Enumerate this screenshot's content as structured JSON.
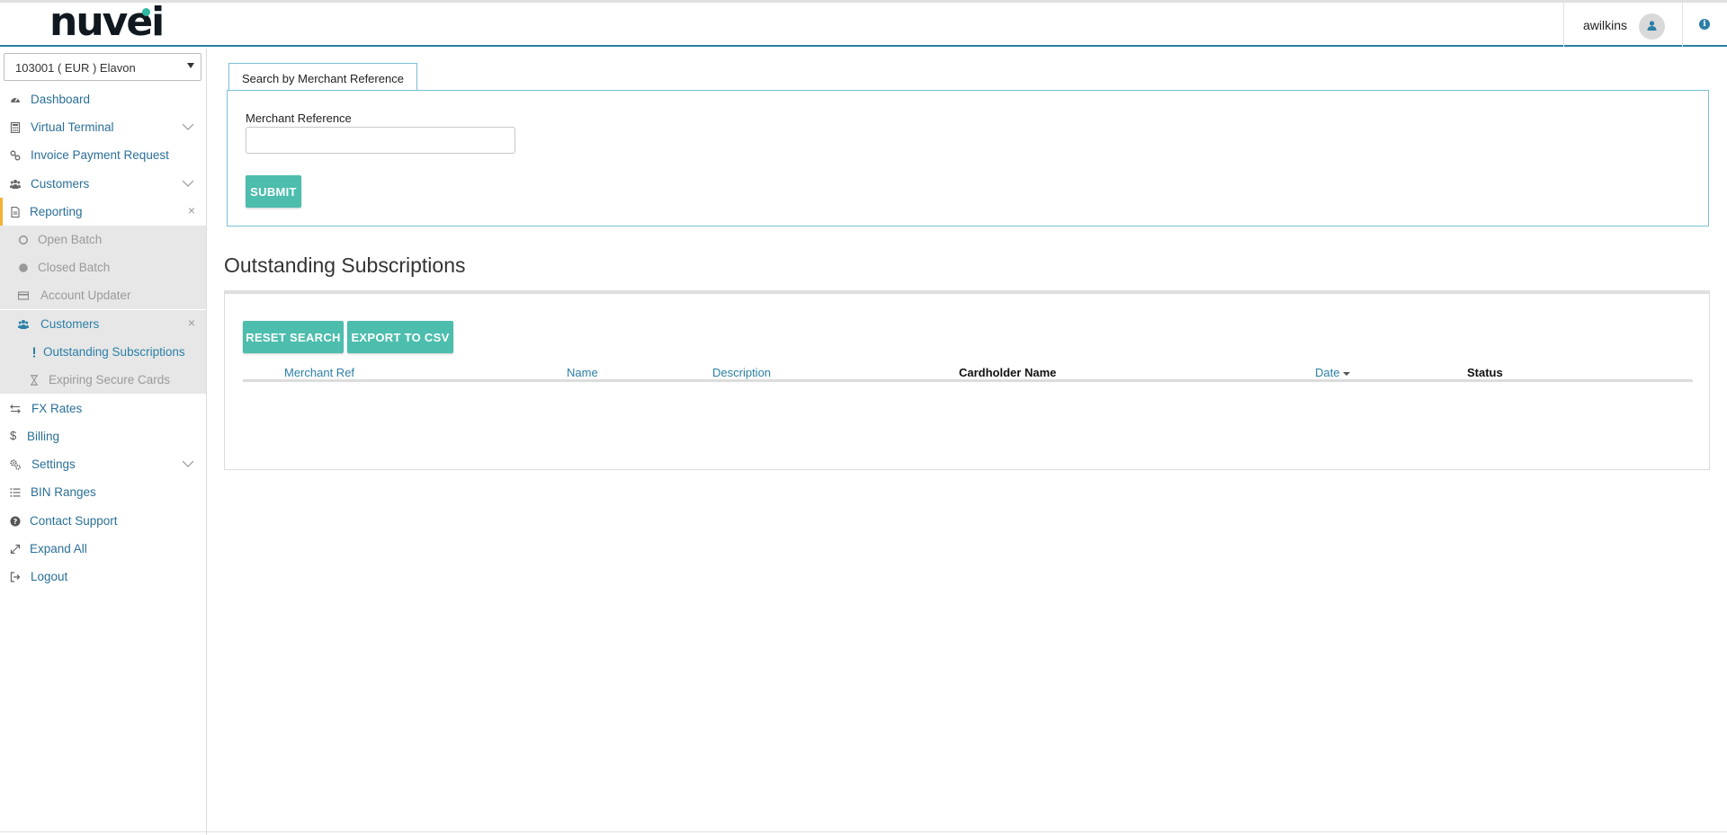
{
  "brand": {
    "logo_text": "nuvei",
    "accent": "#4dbdad",
    "link_color": "#2a7fa6",
    "reporting_marker": "#f2b233"
  },
  "header": {
    "username": "awilkins",
    "user_icon": "user-icon",
    "info_icon": "info-icon"
  },
  "sidebar": {
    "account_select": "103001 ( EUR ) Elavon",
    "items": [
      {
        "label": "Dashboard",
        "icon": "dashboard-icon"
      },
      {
        "label": "Virtual Terminal",
        "icon": "calculator-icon"
      },
      {
        "label": "Invoice Payment Request",
        "icon": "link-icon"
      },
      {
        "label": "Customers",
        "icon": "users-icon"
      },
      {
        "label": "Reporting",
        "icon": "report-icon"
      },
      {
        "label": "Open Batch",
        "icon": "circle-outline-icon"
      },
      {
        "label": "Closed Batch",
        "icon": "circle-filled-icon"
      },
      {
        "label": "Account Updater",
        "icon": "card-icon"
      },
      {
        "label": "Customers",
        "icon": "users-icon"
      },
      {
        "label": "Outstanding Subscriptions",
        "icon": "exclamation-icon"
      },
      {
        "label": "Expiring Secure Cards",
        "icon": "hourglass-icon"
      },
      {
        "label": "FX Rates",
        "icon": "exchange-icon"
      },
      {
        "label": "Billing",
        "icon": "dollar-icon"
      },
      {
        "label": "Settings",
        "icon": "cogs-icon"
      },
      {
        "label": "BIN Ranges",
        "icon": "list-icon"
      },
      {
        "label": "Contact Support",
        "icon": "question-icon"
      },
      {
        "label": "Expand All",
        "icon": "expand-icon"
      },
      {
        "label": "Logout",
        "icon": "logout-icon"
      }
    ]
  },
  "search": {
    "tab_label": "Search by Merchant Reference",
    "field_label": "Merchant Reference",
    "field_value": "",
    "submit_label": "SUBMIT"
  },
  "results": {
    "title": "Outstanding Subscriptions",
    "reset_label": "RESET SEARCH",
    "export_label": "EXPORT TO CSV",
    "columns": [
      "Merchant Ref",
      "Name",
      "Description",
      "Cardholder Name",
      "Date",
      "Status"
    ],
    "rows": []
  }
}
